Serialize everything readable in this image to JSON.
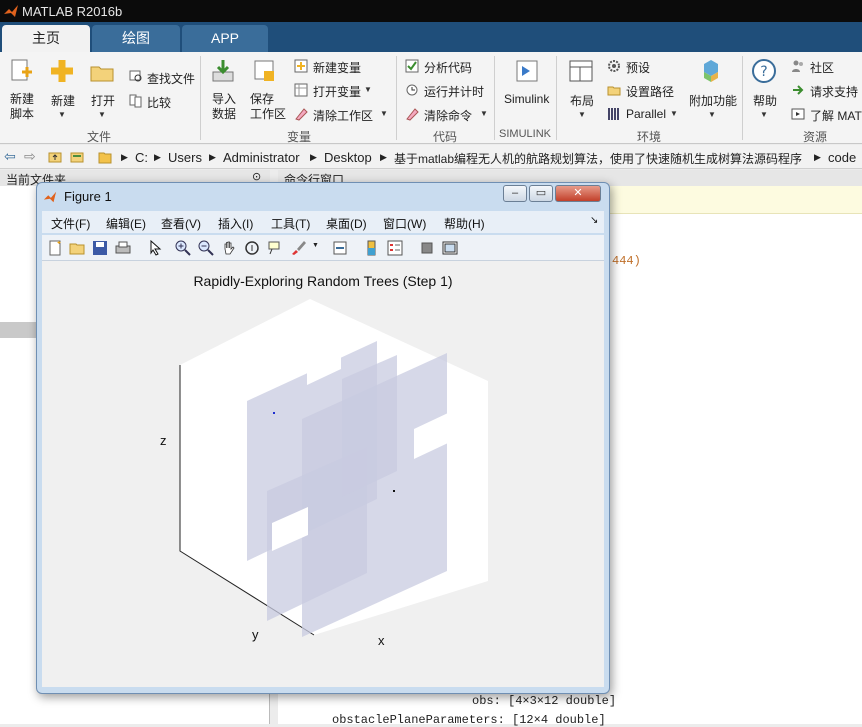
{
  "window": {
    "title": "MATLAB R2016b"
  },
  "tabs": [
    {
      "label": "主页"
    },
    {
      "label": "绘图"
    },
    {
      "label": "APP"
    }
  ],
  "ribbon": {
    "file": {
      "new_script": "新建\n脚本",
      "new": "新建",
      "open": "打开",
      "find_files": "查找文件",
      "compare": "比较",
      "group": "文件"
    },
    "variable": {
      "import": "导入\n数据",
      "save_ws": "保存\n工作区",
      "new_var": "新建变量",
      "open_var": "打开变量",
      "clear_ws": "清除工作区",
      "group": "变量"
    },
    "code": {
      "analyze": "分析代码",
      "run_time": "运行并计时",
      "clear_cmd": "清除命令",
      "group": "代码"
    },
    "simulink": {
      "label": "Simulink",
      "group": "SIMULINK"
    },
    "env": {
      "layout": "布局",
      "prefs": "预设",
      "set_path": "设置路径",
      "parallel": "Parallel",
      "addons": "附加功能",
      "group": "环境"
    },
    "resources": {
      "help": "帮助",
      "community": "社区",
      "support": "请求支持",
      "learn": "了解 MATLAB",
      "group": "资源"
    }
  },
  "address": {
    "parts": [
      "C:",
      "Users",
      "Administrator",
      "Desktop",
      "基于matlab编程无人机的航路规划算法，使用了快速随机生成树算法源码程序",
      "code"
    ]
  },
  "panels": {
    "left_title": "当前文件夹",
    "right_title": "命令行窗口"
  },
  "command": {
    "link_fragment": "444)",
    "line1": "obs: [4×3×12 double]",
    "line2": "obstaclePlaneParameters: [12×4 double]"
  },
  "figure": {
    "title": "Figure 1",
    "menu": [
      "文件(F)",
      "编辑(E)",
      "查看(V)",
      "插入(I)",
      "工具(T)",
      "桌面(D)",
      "窗口(W)",
      "帮助(H)"
    ],
    "plot_title": "Rapidly-Exploring Random Trees (Step 1)",
    "xlabel": "x",
    "ylabel": "y",
    "zlabel": "z"
  },
  "colors": {
    "titlebar": "#0b0b0b",
    "tabbar": "#1f4e7a",
    "plane_fill": "#c8cbe0",
    "point_blue": "#1f2fd0"
  }
}
